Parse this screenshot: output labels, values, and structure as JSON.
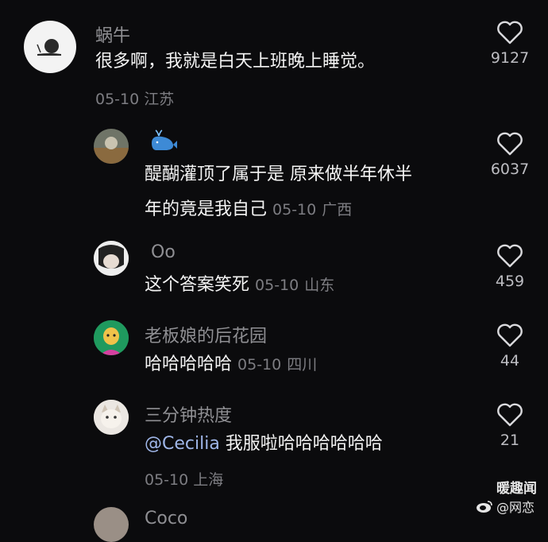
{
  "comments": [
    {
      "name": "蜗牛",
      "text": "很多啊，我就是白天上班晚上睡觉。",
      "date": "05-10",
      "location": "江苏",
      "likes": "9127"
    },
    {
      "name": "",
      "text1": "醍醐灌顶了属于是 原来做半年休半",
      "text2": "年的竟是我自己",
      "date": "05-10",
      "location": "广西",
      "likes": "6037"
    },
    {
      "name": "Oo",
      "text": "这个答案笑死",
      "date": "05-10",
      "location": "山东",
      "likes": "459"
    },
    {
      "name": "老板娘的后花园",
      "text": "哈哈哈哈哈",
      "date": "05-10",
      "location": "四川",
      "likes": "44"
    },
    {
      "name": "三分钟热度",
      "mention": "@Cecilia",
      "text": " 我服啦哈哈哈哈哈哈",
      "date": "05-10",
      "location": "上海",
      "likes": "21"
    },
    {
      "name": "Coco"
    }
  ],
  "watermark": {
    "line1": "暖趣闻",
    "line2": "@网恋"
  },
  "colors": {
    "background": "#0b0b0d",
    "mention": "#9fb6e8"
  }
}
